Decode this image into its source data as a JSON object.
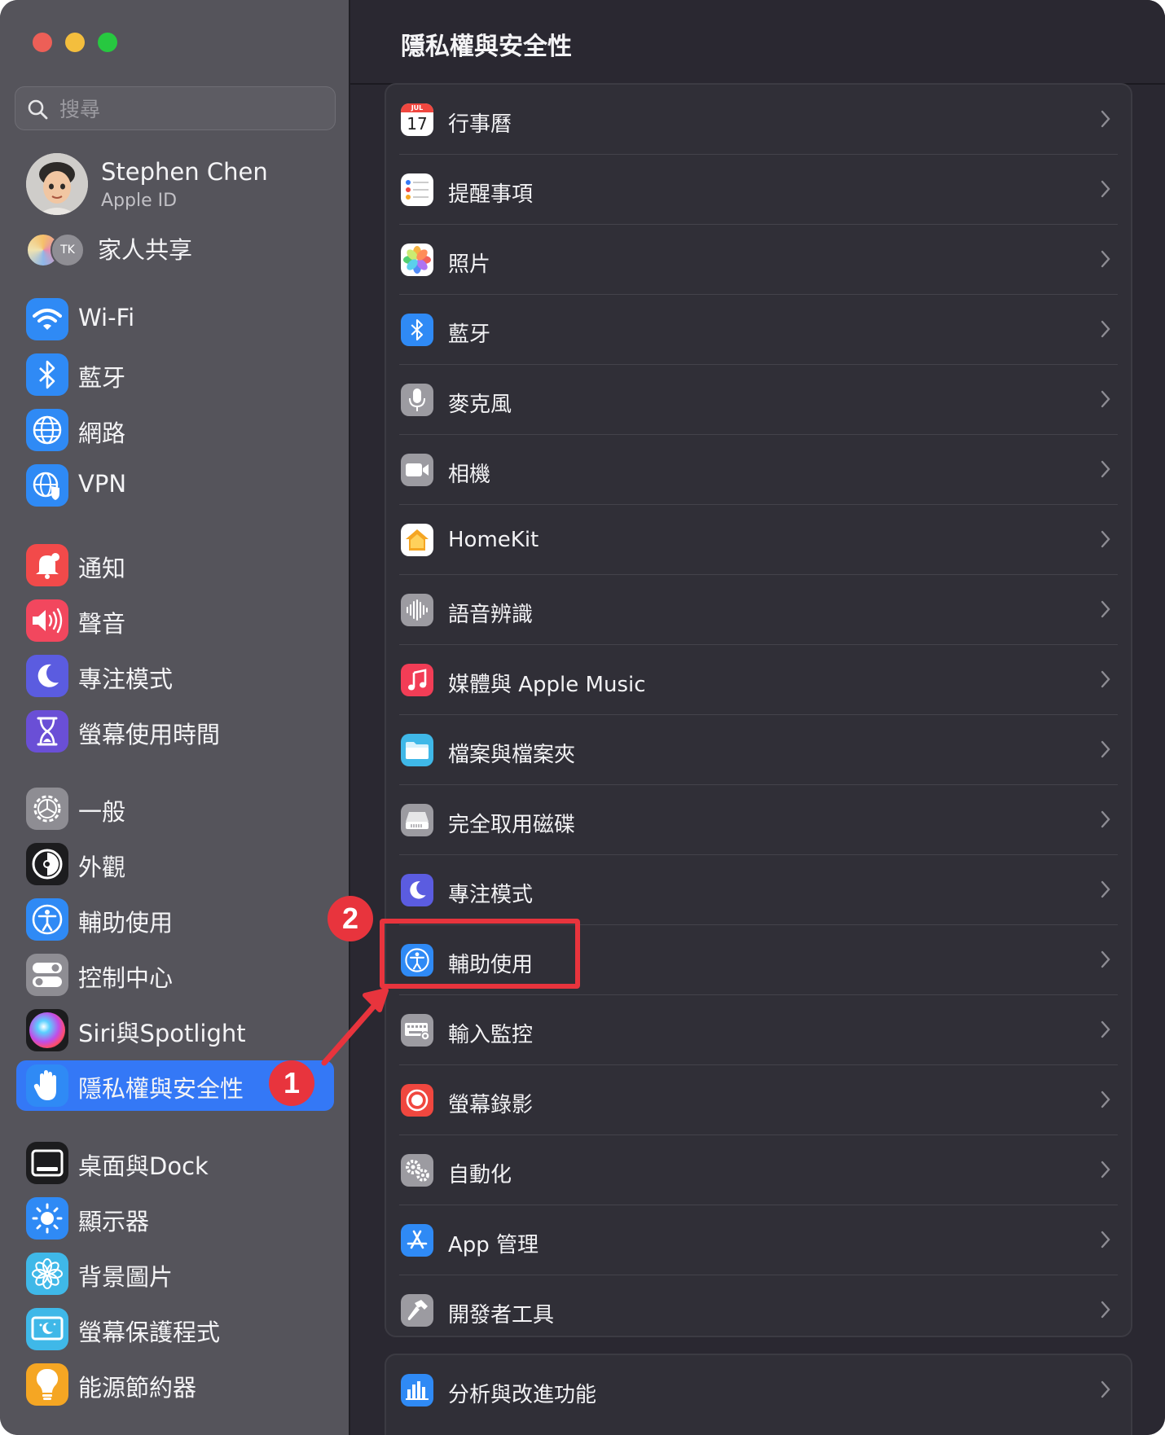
{
  "window": {
    "title": "隱私權與安全性"
  },
  "search": {
    "placeholder": "搜尋"
  },
  "profile": {
    "name": "Stephen Chen",
    "subtitle": "Apple ID"
  },
  "family": {
    "label": "家人共享",
    "member_initials": "TK"
  },
  "sidebar": {
    "items": [
      {
        "label": "Wi-Fi",
        "icon": "wifi-icon",
        "color": "#2f8af5"
      },
      {
        "label": "藍牙",
        "icon": "bluetooth-icon",
        "color": "#2f8af5"
      },
      {
        "label": "網路",
        "icon": "globe-icon",
        "color": "#2f8af5"
      },
      {
        "label": "VPN",
        "icon": "vpn-globe-icon",
        "color": "#2f8af5"
      },
      {
        "label": "通知",
        "icon": "bell-icon",
        "color": "#f24a4a"
      },
      {
        "label": "聲音",
        "icon": "speaker-icon",
        "color": "#f2475e"
      },
      {
        "label": "專注模式",
        "icon": "moon-icon",
        "color": "#5b5ce0"
      },
      {
        "label": "螢幕使用時間",
        "icon": "hourglass-icon",
        "color": "#6a4fd6"
      },
      {
        "label": "一般",
        "icon": "gear-icon",
        "color": "#8e8d93"
      },
      {
        "label": "外觀",
        "icon": "appearance-icon",
        "color": "#1c1c1e"
      },
      {
        "label": "輔助使用",
        "icon": "accessibility-icon",
        "color": "#2f8af5"
      },
      {
        "label": "控制中心",
        "icon": "toggles-icon",
        "color": "#8e8d93"
      },
      {
        "label": "Siri與Spotlight",
        "icon": "siri-icon",
        "color": "#1c1c1e"
      },
      {
        "label": "隱私權與安全性",
        "icon": "hand-icon",
        "color": "#2f8af5",
        "selected": true
      },
      {
        "label": "桌面與Dock",
        "icon": "dock-icon",
        "color": "#1c1c1e"
      },
      {
        "label": "顯示器",
        "icon": "sun-icon",
        "color": "#2f8af5"
      },
      {
        "label": "背景圖片",
        "icon": "flower-icon",
        "color": "#3fb8e8"
      },
      {
        "label": "螢幕保護程式",
        "icon": "screensaver-icon",
        "color": "#3fb8e8"
      },
      {
        "label": "能源節約器",
        "icon": "lightbulb-icon",
        "color": "#f5a623"
      }
    ]
  },
  "privacy_list": {
    "items": [
      {
        "label": "行事曆",
        "icon": "calendar-icon",
        "calendar_month": "JUL",
        "calendar_day": "17"
      },
      {
        "label": "提醒事項",
        "icon": "reminders-icon"
      },
      {
        "label": "照片",
        "icon": "photos-icon"
      },
      {
        "label": "藍牙",
        "icon": "bluetooth-icon"
      },
      {
        "label": "麥克風",
        "icon": "microphone-icon"
      },
      {
        "label": "相機",
        "icon": "camera-icon"
      },
      {
        "label": "HomeKit",
        "icon": "home-icon"
      },
      {
        "label": "語音辨識",
        "icon": "waveform-icon"
      },
      {
        "label": "媒體與 Apple Music",
        "icon": "music-note-icon"
      },
      {
        "label": "檔案與檔案夾",
        "icon": "folder-icon"
      },
      {
        "label": "完全取用磁碟",
        "icon": "disk-icon"
      },
      {
        "label": "專注模式",
        "icon": "moon-icon"
      },
      {
        "label": "輔助使用",
        "icon": "accessibility-icon"
      },
      {
        "label": "輸入監控",
        "icon": "keyboard-icon"
      },
      {
        "label": "螢幕錄影",
        "icon": "record-icon"
      },
      {
        "label": "自動化",
        "icon": "gears-icon"
      },
      {
        "label": "App 管理",
        "icon": "app-store-icon"
      },
      {
        "label": "開發者工具",
        "icon": "hammer-icon"
      }
    ]
  },
  "analytics": {
    "label": "分析與改進功能",
    "icon": "bar-chart-icon"
  },
  "annotations": {
    "step1": "1",
    "step2": "2",
    "color": "#e8343d"
  }
}
